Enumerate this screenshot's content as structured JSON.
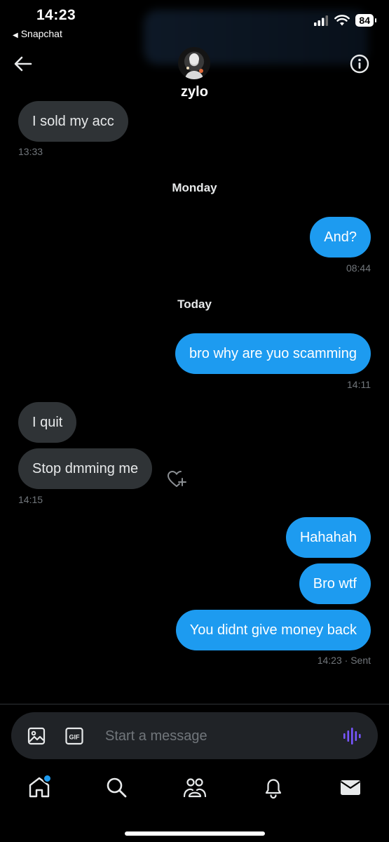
{
  "status_bar": {
    "time": "14:23",
    "back_app": "Snapchat",
    "battery": "84",
    "signal_icon": "cellular-signal-icon",
    "wifi_icon": "wifi-icon"
  },
  "header": {
    "username": "zylo",
    "back_icon": "back-arrow-icon",
    "info_icon": "info-icon"
  },
  "messages": [
    {
      "id": "m1",
      "direction": "incoming",
      "text": "I sold my acc",
      "time": "13:33"
    },
    {
      "id": "d1",
      "type": "day_separator",
      "text": "Monday"
    },
    {
      "id": "m2",
      "direction": "outgoing",
      "text": "And?",
      "time": "08:44"
    },
    {
      "id": "d2",
      "type": "day_separator",
      "text": "Today"
    },
    {
      "id": "m3",
      "direction": "outgoing",
      "text": "bro why are yuo scamming",
      "time": "14:11"
    },
    {
      "id": "m4",
      "direction": "incoming",
      "text": "I quit"
    },
    {
      "id": "m5",
      "direction": "incoming",
      "text": "Stop dmming me",
      "time": "14:15"
    },
    {
      "id": "m6",
      "direction": "outgoing",
      "text": "Hahahah"
    },
    {
      "id": "m7",
      "direction": "outgoing",
      "text": "Bro wtf"
    },
    {
      "id": "m8",
      "direction": "outgoing",
      "text": "You didnt give money back",
      "time": "14:23",
      "status": "Sent"
    }
  ],
  "last_sent_meta": "14:23 · Sent",
  "composer": {
    "placeholder": "Start a message",
    "image_icon": "image-icon",
    "gif_icon": "gif-icon",
    "voice_icon": "voice-wave-icon"
  },
  "tabs": [
    {
      "name": "home",
      "icon": "home-icon",
      "has_notification": true
    },
    {
      "name": "search",
      "icon": "search-icon"
    },
    {
      "name": "communities",
      "icon": "people-icon"
    },
    {
      "name": "notifications",
      "icon": "bell-icon"
    },
    {
      "name": "messages",
      "icon": "mail-icon",
      "active": true
    }
  ],
  "colors": {
    "background": "#000000",
    "outgoing_bubble": "#1d9bf0",
    "incoming_bubble": "#2f3336",
    "muted_text": "#71767b",
    "voice_accent": "#7856ff"
  }
}
